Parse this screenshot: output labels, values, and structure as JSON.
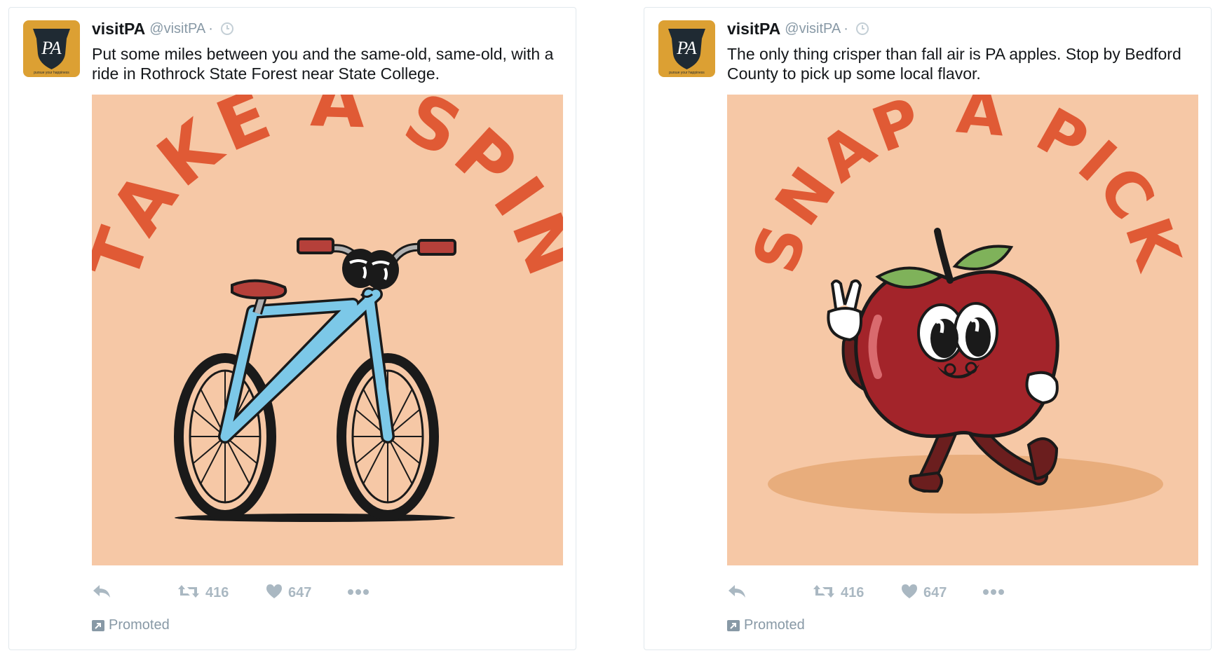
{
  "tweets": [
    {
      "name": "visitPA",
      "handle": "@visitPA",
      "separator": "·",
      "text": "Put some miles between you and the same-old, same-old, with a ride in Rothrock State Forest near State College.",
      "image_headline": "TAKE A SPIN",
      "retweets": "416",
      "likes": "647",
      "promoted": "Promoted",
      "avatar_text": "PA",
      "avatar_tagline": "pursue your happiness"
    },
    {
      "name": "visitPA",
      "handle": "@visitPA",
      "separator": "·",
      "text": "The only thing crisper than fall air is PA apples. Stop by Bedford County to pick up some local flavor.",
      "image_headline": "SNAP A PICK",
      "retweets": "416",
      "likes": "647",
      "promoted": "Promoted",
      "avatar_text": "PA",
      "avatar_tagline": "pursue your happiness"
    }
  ],
  "colors": {
    "image_bg": "#f6c8a6",
    "headline": "#e05a35",
    "avatar_bg": "#dca033",
    "action_gray": "#aab8c2",
    "bike_frame": "#7cc8e8",
    "apple_red": "#a3242a",
    "leaf_green": "#7fb25a"
  },
  "icons": [
    "reply-icon",
    "retweet-icon",
    "heart-icon",
    "more-icon",
    "clock-icon",
    "promoted-icon"
  ]
}
